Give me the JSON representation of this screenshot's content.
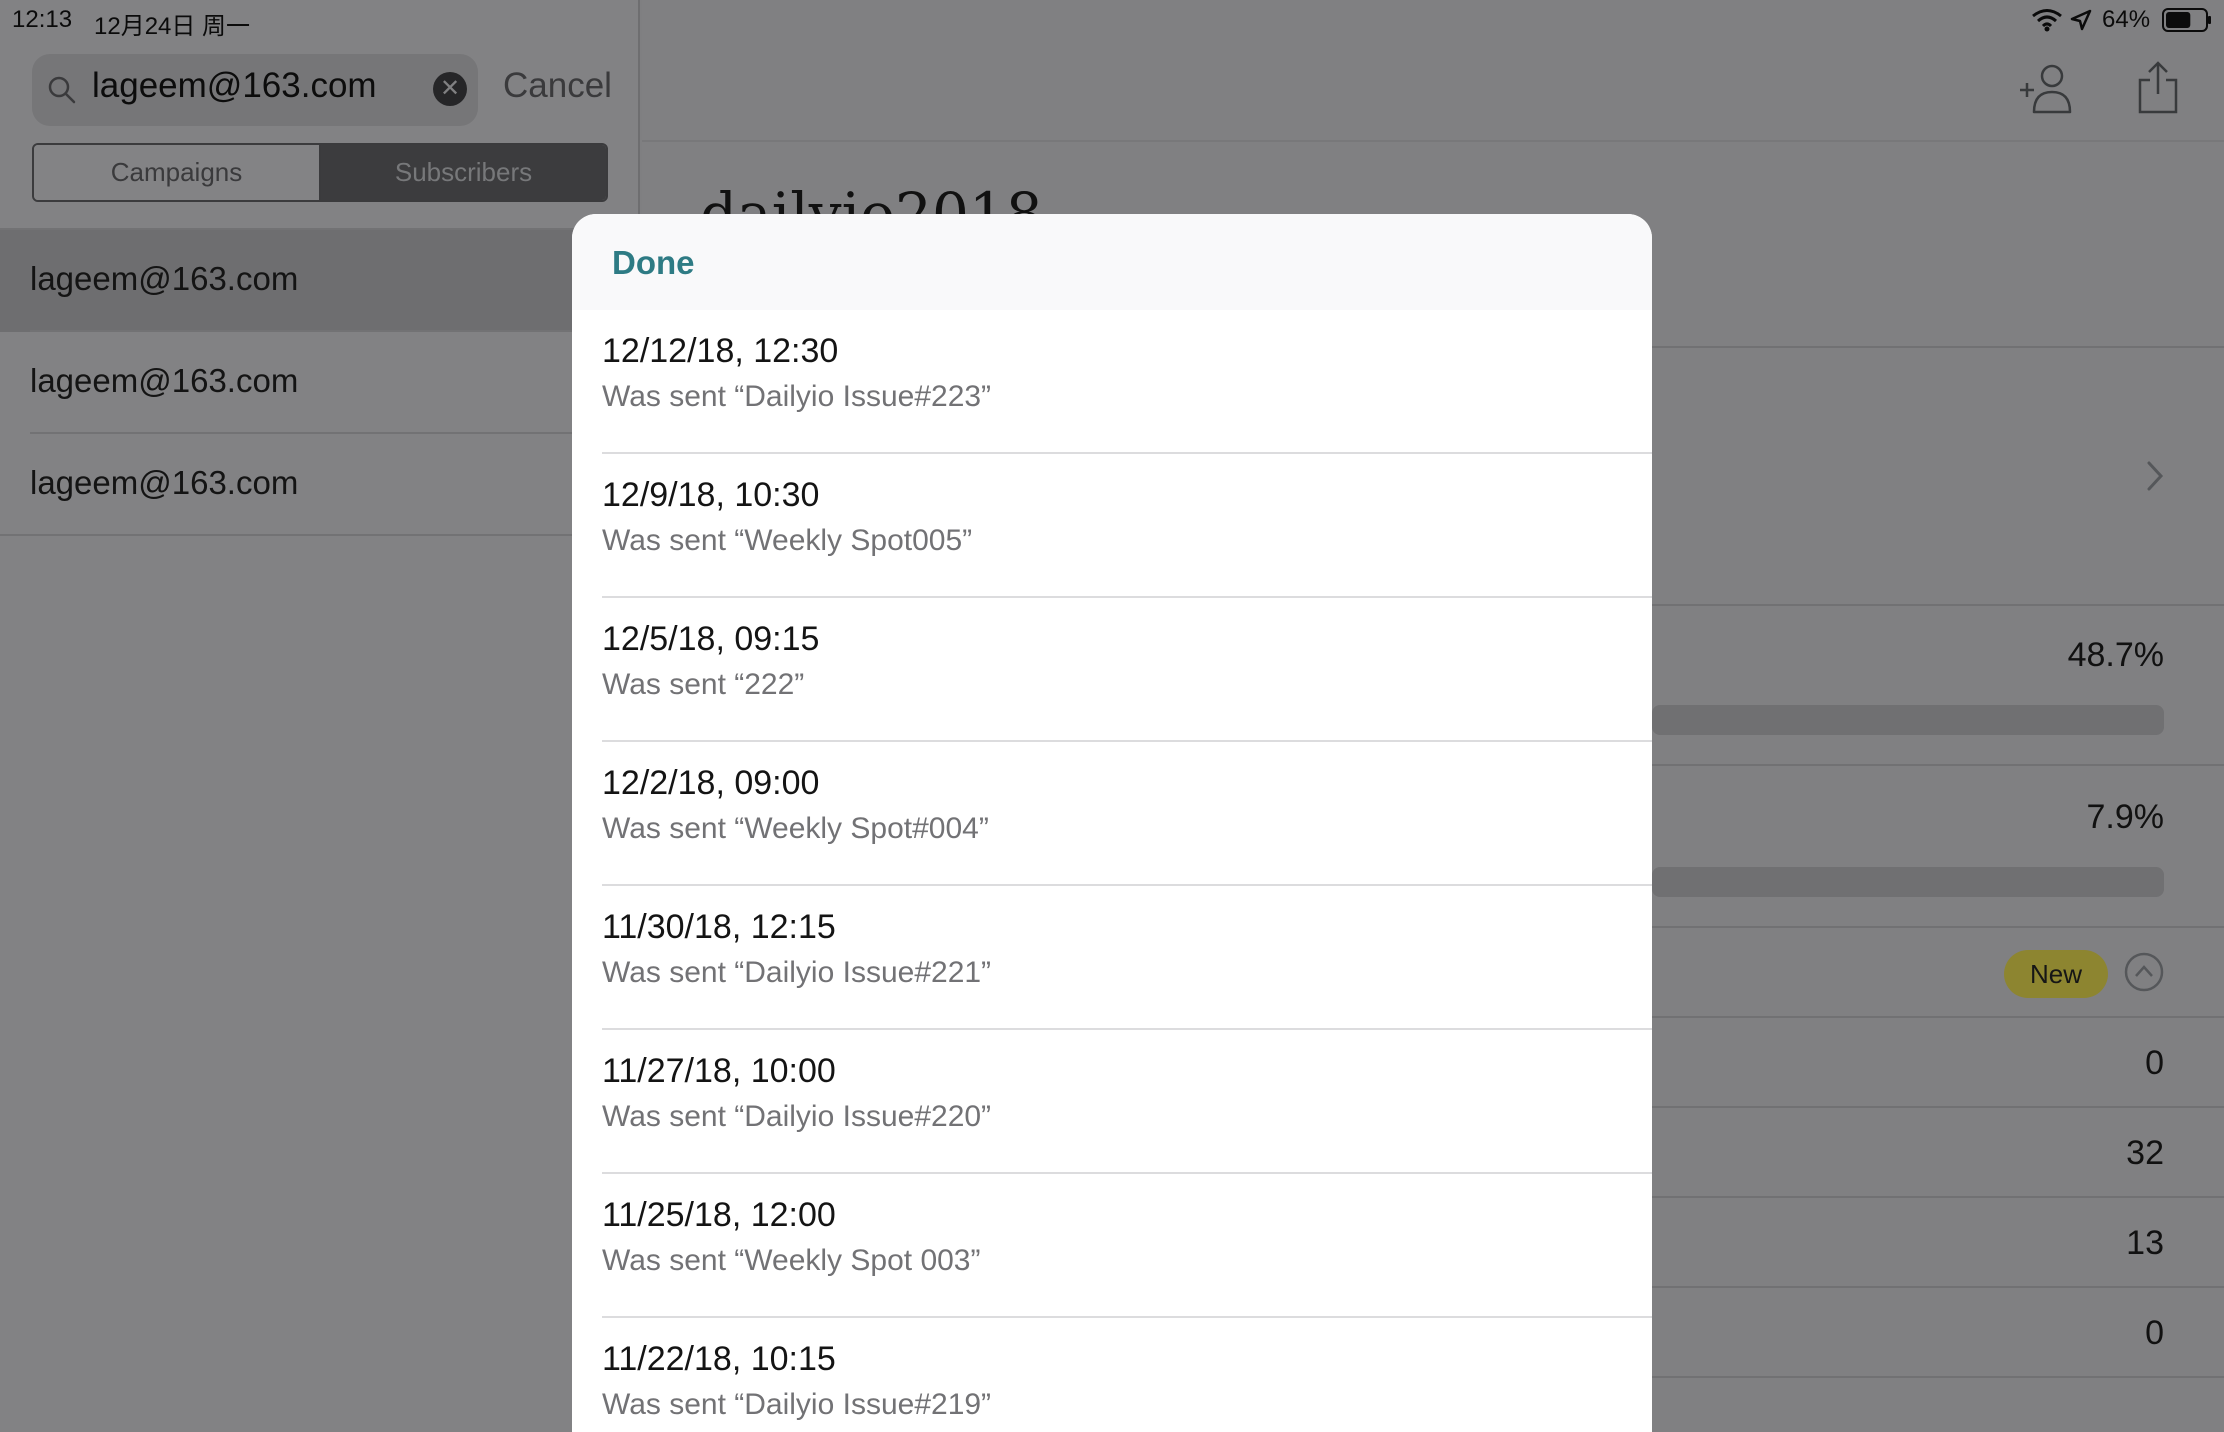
{
  "status_bar": {
    "time": "12:13",
    "date": "12月24日 周一",
    "battery_percent": "64%",
    "battery_level": 0.64
  },
  "search": {
    "value": "lageem@163.com",
    "cancel_label": "Cancel"
  },
  "segmented": {
    "campaigns_label": "Campaigns",
    "subscribers_label": "Subscribers",
    "selected": "Subscribers"
  },
  "results": [
    {
      "label": "lageem@163.com",
      "selected": true
    },
    {
      "label": "lageem@163.com",
      "selected": false
    },
    {
      "label": "lageem@163.com",
      "selected": false
    }
  ],
  "detail": {
    "title": "dailyio2018",
    "stats": [
      {
        "value": "48.7%",
        "fraction": 0.487
      },
      {
        "value": "7.9%",
        "fraction": 0.079
      }
    ],
    "badge_label": "New",
    "counts": [
      "0",
      "32",
      "13",
      "0"
    ]
  },
  "sheet": {
    "done_label": "Done",
    "messages": [
      {
        "date": "12/12/18, 12:30",
        "subtitle": "Was sent “Dailyio Issue#223”"
      },
      {
        "date": "12/9/18, 10:30",
        "subtitle": "Was sent “Weekly Spot005”"
      },
      {
        "date": "12/5/18, 09:15",
        "subtitle": "Was sent “222”"
      },
      {
        "date": "12/2/18, 09:00",
        "subtitle": "Was sent “Weekly Spot#004”"
      },
      {
        "date": "11/30/18, 12:15",
        "subtitle": "Was sent “Dailyio Issue#221”"
      },
      {
        "date": "11/27/18, 10:00",
        "subtitle": "Was sent “Dailyio Issue#220”"
      },
      {
        "date": "11/25/18, 12:00",
        "subtitle": "Was sent “Weekly Spot 003”"
      },
      {
        "date": "11/22/18, 10:15",
        "subtitle": "Was sent “Dailyio Issue#219”"
      }
    ]
  },
  "colors": {
    "accent": "#2e7b84",
    "badge": "#d4c84a",
    "dim_background": "#7f7f81"
  },
  "icons": [
    "search-icon",
    "clear-icon",
    "wifi-icon",
    "location-icon",
    "battery-icon",
    "add-subscriber-icon",
    "share-icon",
    "chevron-right-icon",
    "collapse-icon"
  ]
}
